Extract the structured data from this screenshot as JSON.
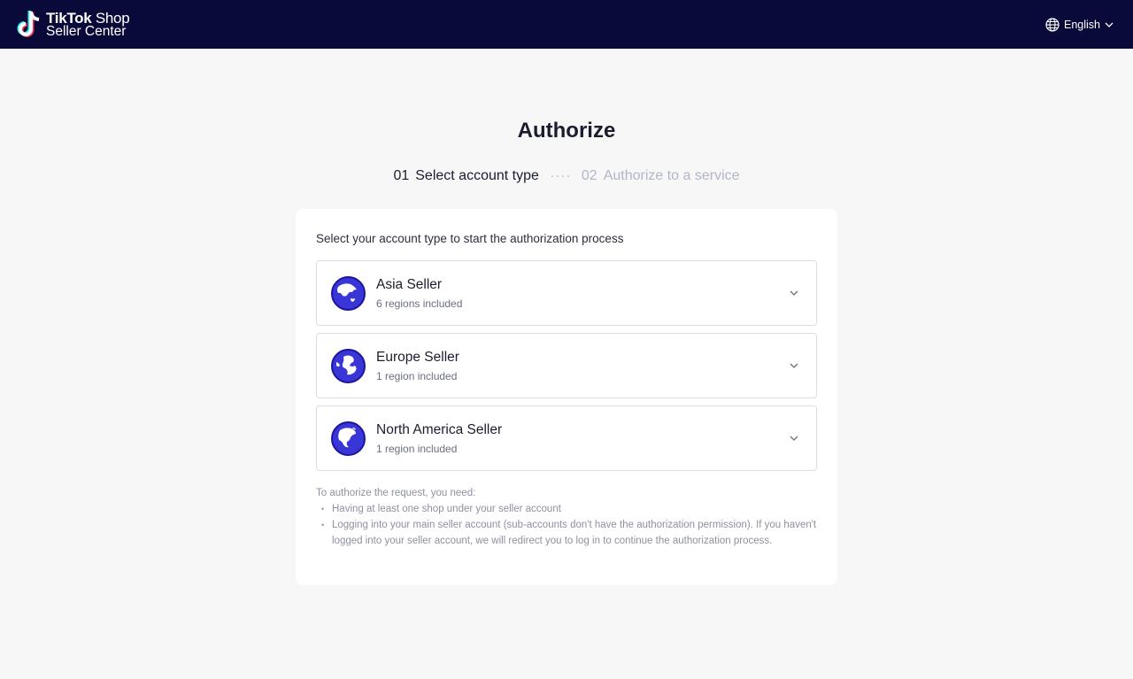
{
  "header": {
    "brand_line1_bold": "TikTok",
    "brand_line1_rest": " Shop",
    "brand_line2": "Seller Center",
    "language": "English",
    "icons": {
      "logo": "tiktok-logo",
      "language": "globe-icon",
      "dropdown": "chevron-down-icon"
    }
  },
  "page": {
    "title": "Authorize",
    "steps": [
      {
        "num": "01",
        "label": "Select account type",
        "state": "active"
      },
      {
        "num": "02",
        "label": "Authorize to a service",
        "state": "inactive"
      }
    ]
  },
  "card": {
    "intro": "Select your account type to start the authorization process",
    "options": [
      {
        "name": "Asia Seller",
        "sub": "6 regions included"
      },
      {
        "name": "Europe Seller",
        "sub": "1 region included"
      },
      {
        "name": "North America Seller",
        "sub": "1 region included"
      }
    ],
    "notes_title": "To authorize the request, you need:",
    "notes": [
      "Having at least one shop under your seller account",
      "Logging into your main seller account (sub-accounts don't have the authorization permission). If you haven't logged into your seller account, we will redirect you to log in to continue the authorization process."
    ]
  },
  "colors": {
    "topbar": "#0a0a3a",
    "accent_globe": "#3a35d6",
    "page_bg": "#f7f7f8"
  }
}
